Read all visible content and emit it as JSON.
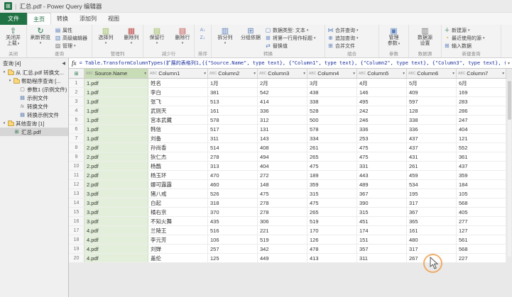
{
  "window": {
    "title": "汇总.pdf - Power Query 编辑器"
  },
  "tabs": {
    "file": "文件",
    "home": "主页",
    "transform": "转换",
    "add_column": "添加列",
    "view": "视图"
  },
  "ribbon": {
    "close": {
      "group": "关闭",
      "close_load_l1": "关闭并",
      "close_load_l2": "上载"
    },
    "query": {
      "group": "查询",
      "refresh": "刷新预览",
      "properties": "属性",
      "advanced_editor": "高级编辑器",
      "manage": "管理"
    },
    "manage_columns": {
      "group": "管理列",
      "choose_columns": "选择列",
      "remove_columns": "删除列"
    },
    "reduce_rows": {
      "group": "减少行",
      "keep_rows": "保留行",
      "remove_rows": "删除行"
    },
    "sort": {
      "group": "排序"
    },
    "transform": {
      "group": "转换",
      "split_column": "拆分列",
      "group_by": "分组依据",
      "data_type": "数据类型: 文本",
      "first_row_headers": "将第一行用作标题",
      "replace_values": "替换值"
    },
    "combine": {
      "group": "组合",
      "merge_queries": "合并查询",
      "append_queries": "追加查询",
      "combine_files": "合并文件"
    },
    "parameters": {
      "group": "参数",
      "manage_parameters_l1": "管理",
      "manage_parameters_l2": "参数"
    },
    "data_sources": {
      "group": "数据源",
      "settings_l1": "数据源",
      "settings_l2": "设置"
    },
    "new_query": {
      "group": "新建查询",
      "new_source": "新建源",
      "recent_sources": "最近使用的源",
      "enter_data": "输入数据"
    }
  },
  "formula_bar": {
    "fx": "fx",
    "formula": "= Table.TransformColumnTypes(扩展的表格列1,{{\"Source.Name\", type text}, {\"Column1\", type text}, {\"Column2\", type text}, {\"Column3\", type text}, {\"Column4\", type text}, {\"Co"
  },
  "queries_pane": {
    "header": "查询 [4]",
    "items": [
      {
        "label": "从 汇总.pdf 转换文...",
        "depth": 0,
        "icon": "folder",
        "folder": true
      },
      {
        "label": "帮助程序查询 [...",
        "depth": 1,
        "icon": "folder",
        "folder": true
      },
      {
        "label": "参数1 (示例文件)",
        "depth": 2,
        "icon": "parameter"
      },
      {
        "label": "示例文件",
        "depth": 2,
        "icon": "worksheet"
      },
      {
        "label": "转换文件",
        "depth": 2,
        "icon": "function"
      },
      {
        "label": "转换示例文件",
        "depth": 2,
        "icon": "worksheet"
      },
      {
        "label": "其他查询 [1]",
        "depth": 0,
        "icon": "folder",
        "folder": true
      },
      {
        "label": "汇总.pdf",
        "depth": 1,
        "icon": "table",
        "selected": true
      }
    ]
  },
  "grid": {
    "type_icon": "ABC",
    "columns": [
      "Source.Name",
      "Column1",
      "Column2",
      "Column3",
      "Column4",
      "Column5",
      "Column6",
      "Column7"
    ],
    "rows": [
      [
        "1.pdf",
        "姓名",
        "1月",
        "2月",
        "3月",
        "4月",
        "5月",
        "6月"
      ],
      [
        "1.pdf",
        "李白",
        "381",
        "542",
        "438",
        "146",
        "409",
        "169"
      ],
      [
        "1.pdf",
        "张飞",
        "513",
        "414",
        "338",
        "495",
        "597",
        "283"
      ],
      [
        "1.pdf",
        "武则天",
        "161",
        "336",
        "528",
        "242",
        "128",
        "286"
      ],
      [
        "1.pdf",
        "宫本武藏",
        "578",
        "312",
        "500",
        "246",
        "338",
        "247"
      ],
      [
        "1.pdf",
        "韩信",
        "517",
        "131",
        "578",
        "336",
        "336",
        "404"
      ],
      [
        "1.pdf",
        "刘备",
        "311",
        "143",
        "334",
        "253",
        "437",
        "121"
      ],
      [
        "2.pdf",
        "孙尚香",
        "514",
        "408",
        "261",
        "475",
        "437",
        "552"
      ],
      [
        "2.pdf",
        "狄仁杰",
        "278",
        "494",
        "265",
        "475",
        "431",
        "361"
      ],
      [
        "2.pdf",
        "杨戬",
        "313",
        "404",
        "475",
        "331",
        "261",
        "437"
      ],
      [
        "2.pdf",
        "杨玉环",
        "470",
        "272",
        "189",
        "443",
        "459",
        "359"
      ],
      [
        "2.pdf",
        "娜可露露",
        "460",
        "148",
        "359",
        "489",
        "534",
        "184"
      ],
      [
        "3.pdf",
        "猪八戒",
        "526",
        "475",
        "315",
        "367",
        "195",
        "105"
      ],
      [
        "3.pdf",
        "白起",
        "318",
        "278",
        "475",
        "390",
        "317",
        "568"
      ],
      [
        "3.pdf",
        "橘右京",
        "370",
        "278",
        "265",
        "315",
        "367",
        "405"
      ],
      [
        "3.pdf",
        "不知火舞",
        "435",
        "306",
        "519",
        "451",
        "365",
        "277"
      ],
      [
        "4.pdf",
        "兰陵王",
        "516",
        "221",
        "170",
        "174",
        "161",
        "127"
      ],
      [
        "4.pdf",
        "李元芳",
        "106",
        "519",
        "126",
        "151",
        "480",
        "561"
      ],
      [
        "4.pdf",
        "刘婵",
        "257",
        "342",
        "478",
        "357",
        "317",
        "568"
      ],
      [
        "4.pdf",
        "盖伦",
        "125",
        "449",
        "413",
        "311",
        "267",
        "227"
      ]
    ]
  },
  "colors": {
    "accent_green": "#217346",
    "selected_column_fill": "#e3efda",
    "click_ring": "#f0a04e"
  }
}
